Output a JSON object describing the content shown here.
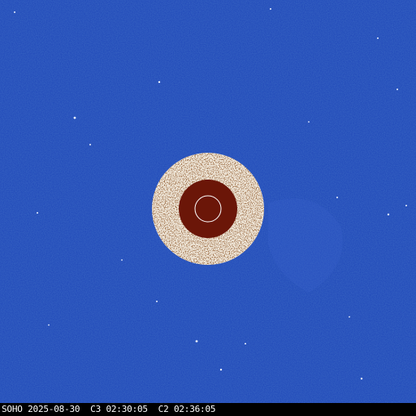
{
  "caption": "SOHO 2025-08-30  C3 02:30:05  C2 02:36:05",
  "colors": {
    "sky": "#1f47b8",
    "sky_dark": "#173a9e",
    "sky_light": "#3a66d6",
    "occulter_ring": "#efe6d8",
    "occulter_speckle": "#5a2b14",
    "occulter_disk": "#6b1608",
    "sun_outline": "#ffffff",
    "caption_bg": "#000000",
    "caption_text": "#ffffff"
  }
}
